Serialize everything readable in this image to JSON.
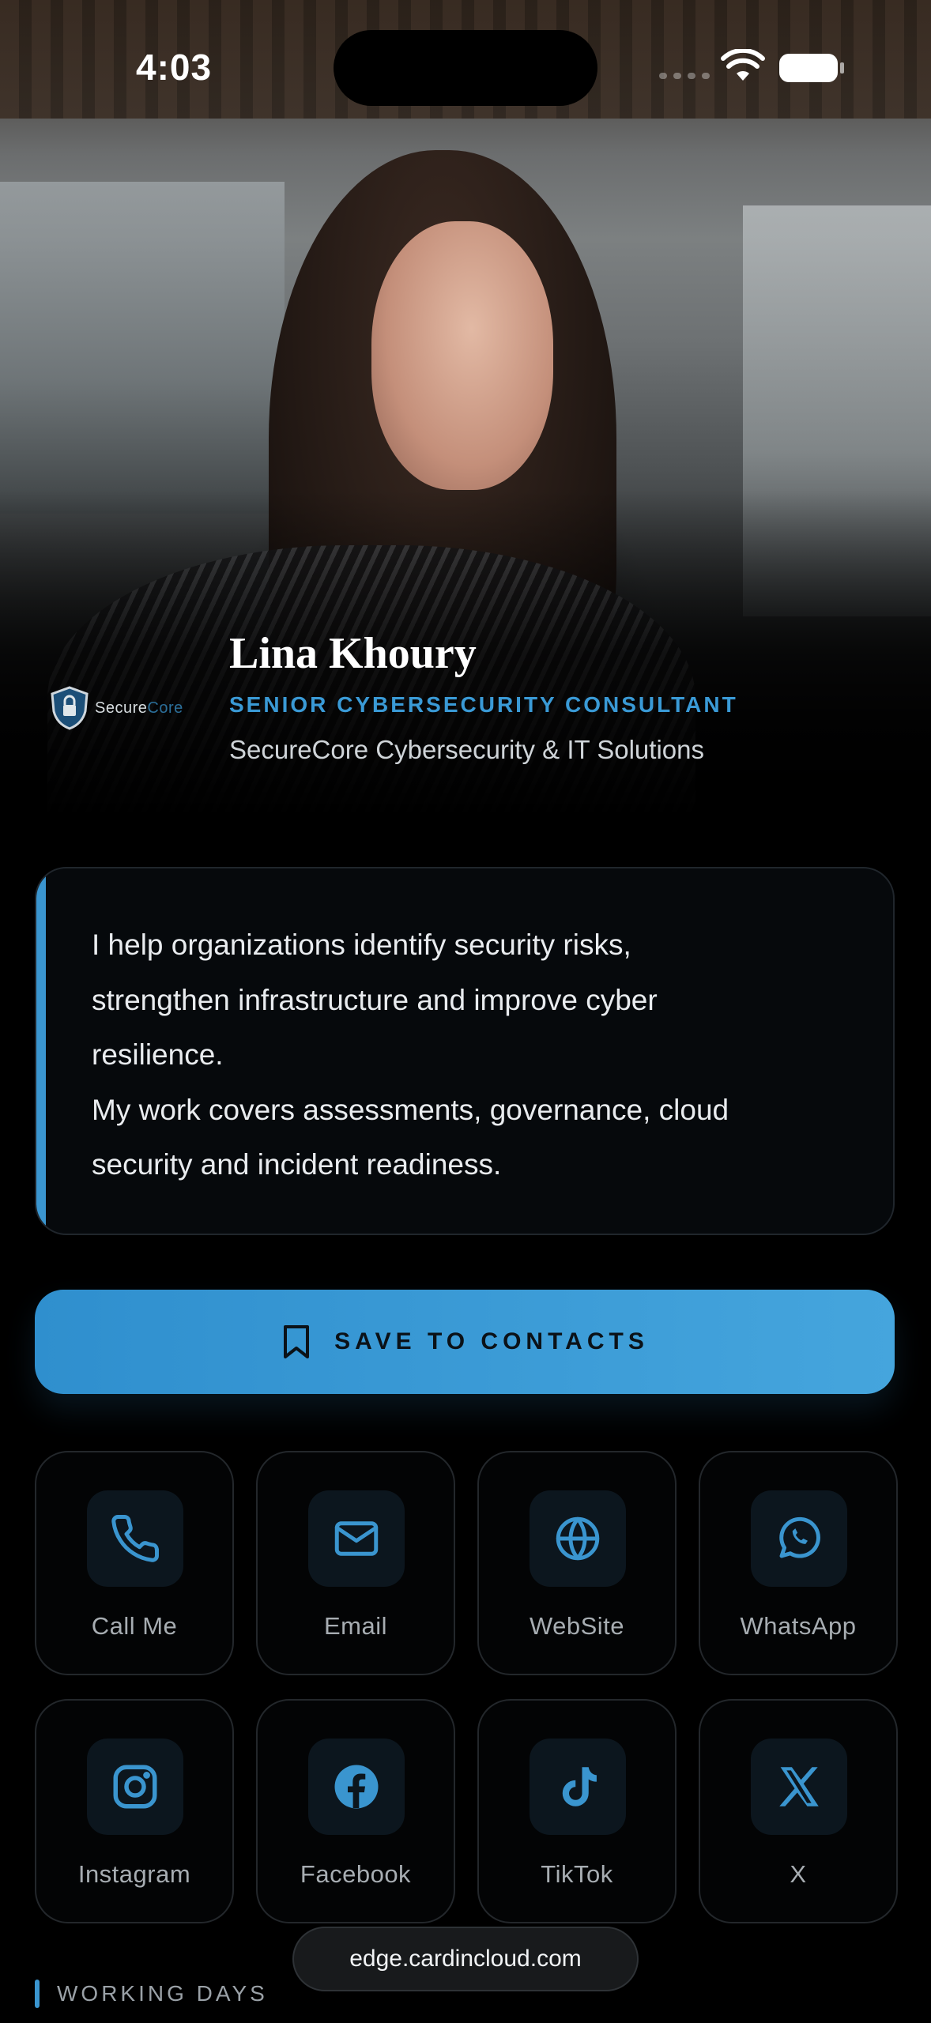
{
  "status_bar": {
    "time": "4:03"
  },
  "profile": {
    "name": "Lina Khoury",
    "role": "SENIOR CYBERSECURITY CONSULTANT",
    "company": "SecureCore Cybersecurity & IT Solutions",
    "logo_text_a": "Secure",
    "logo_text_b": "Core"
  },
  "bio": {
    "lines": [
      "I help organizations identify security risks,",
      "strengthen infrastructure and improve cyber",
      "resilience.",
      "My work covers assessments, governance, cloud",
      "security and incident readiness."
    ]
  },
  "save_button": {
    "label": "SAVE TO CONTACTS",
    "icon": "bookmark-icon"
  },
  "contacts": [
    {
      "label": "Call Me",
      "icon": "phone-icon"
    },
    {
      "label": "Email",
      "icon": "mail-icon"
    },
    {
      "label": "WebSite",
      "icon": "globe-icon"
    },
    {
      "label": "WhatsApp",
      "icon": "whatsapp-icon"
    },
    {
      "label": "Instagram",
      "icon": "instagram-icon"
    },
    {
      "label": "Facebook",
      "icon": "facebook-icon"
    },
    {
      "label": "TikTok",
      "icon": "tiktok-icon"
    },
    {
      "label": "X",
      "icon": "x-icon"
    }
  ],
  "url_bar": {
    "url": "edge.cardincloud.com"
  },
  "section": {
    "title": "WORKING DAYS"
  },
  "colors": {
    "accent": "#3a95cf",
    "background": "#000000",
    "card": "#06090c"
  }
}
